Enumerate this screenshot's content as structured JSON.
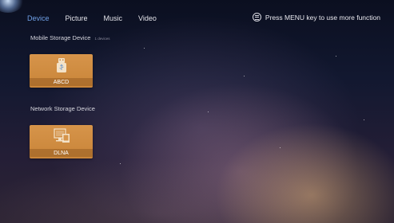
{
  "tabs": [
    {
      "label": "Device",
      "active": true
    },
    {
      "label": "Picture",
      "active": false
    },
    {
      "label": "Music",
      "active": false
    },
    {
      "label": "Video",
      "active": false
    }
  ],
  "hint": {
    "icon": "menu-icon",
    "text": "Press MENU key to use more function"
  },
  "sections": {
    "mobile": {
      "title": "Mobile Storage Device",
      "count": "1 devices",
      "items": [
        {
          "label": "ABCD",
          "icon": "usb-drive-icon"
        }
      ]
    },
    "network": {
      "title": "Network Storage Device",
      "items": [
        {
          "label": "DLNA",
          "icon": "network-screen-icon"
        }
      ]
    }
  },
  "colors": {
    "active_tab": "#6fa0e6",
    "tile": "#d18e43"
  }
}
